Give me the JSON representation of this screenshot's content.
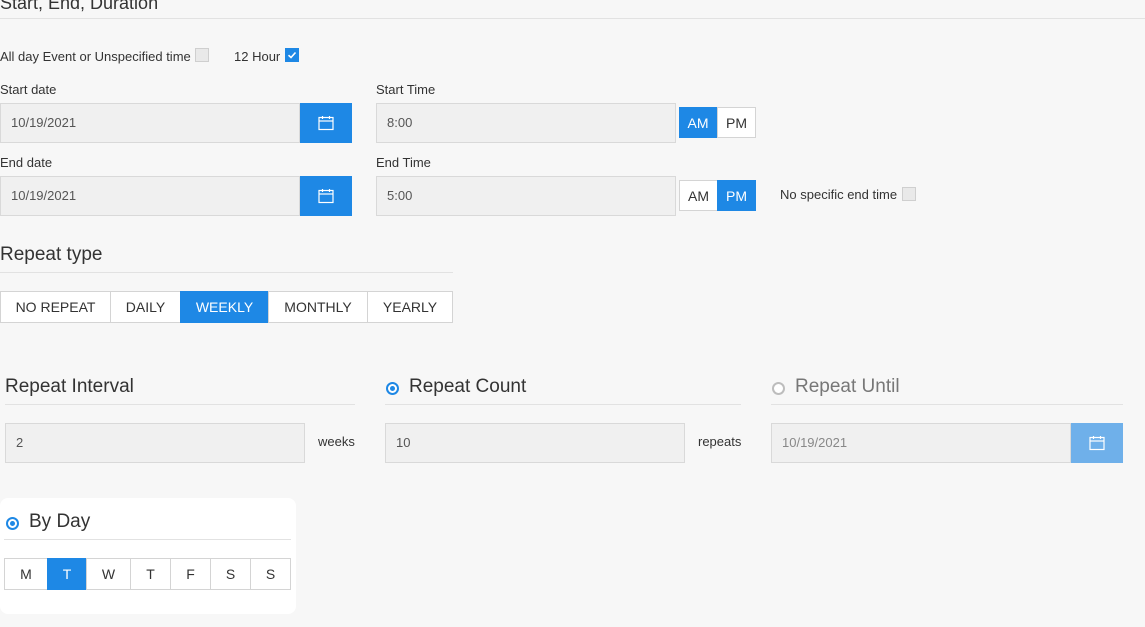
{
  "section": {
    "title": "Start, End, Duration"
  },
  "options": {
    "all_day_label": "All day Event or Unspecified time",
    "all_day_checked": false,
    "twelve_hour_label": "12 Hour",
    "twelve_hour_checked": true
  },
  "start_date": {
    "label": "Start date",
    "value": "10/19/2021"
  },
  "start_time": {
    "label": "Start Time",
    "value": "8:00",
    "am": "AM",
    "pm": "PM",
    "selected": "AM"
  },
  "end_date": {
    "label": "End date",
    "value": "10/19/2021"
  },
  "end_time": {
    "label": "End Time",
    "value": "5:00",
    "am": "AM",
    "pm": "PM",
    "selected": "PM"
  },
  "no_end_time": {
    "label": "No specific end time",
    "checked": false
  },
  "repeat_type": {
    "title": "Repeat type",
    "options": [
      "NO REPEAT",
      "DAILY",
      "WEEKLY",
      "MONTHLY",
      "YEARLY"
    ],
    "selected": "WEEKLY"
  },
  "repeat_interval": {
    "title": "Repeat Interval",
    "value": "2",
    "unit": "weeks"
  },
  "repeat_count": {
    "title": "Repeat Count",
    "value": "10",
    "unit": "repeats",
    "selected": true
  },
  "repeat_until": {
    "title": "Repeat Until",
    "value": "10/19/2021",
    "selected": false
  },
  "by_day": {
    "title": "By Day",
    "selected": true,
    "days": [
      "M",
      "T",
      "W",
      "T",
      "F",
      "S",
      "S"
    ],
    "active_index": 1
  },
  "colors": {
    "accent": "#1e88e5",
    "background": "#f7f7f7"
  }
}
